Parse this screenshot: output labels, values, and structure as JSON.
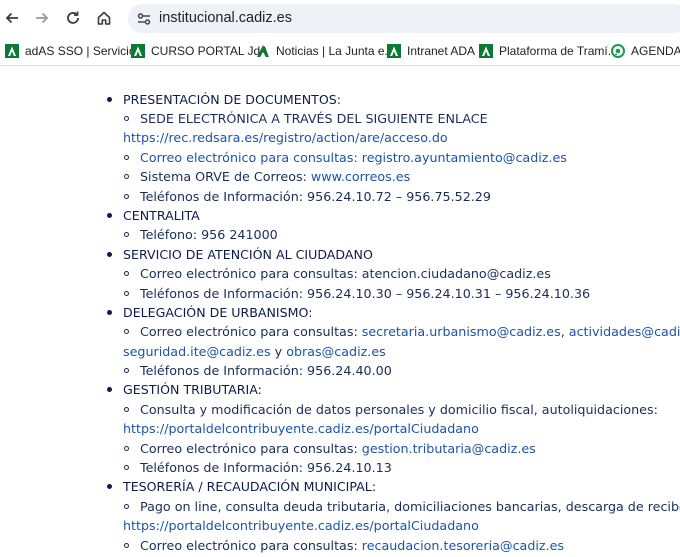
{
  "browser": {
    "url": "institucional.cadiz.es",
    "bookmarks": [
      {
        "label": "adAS SSO | Servicio...",
        "icon": "junta-andalucia-icon"
      },
      {
        "label": "CURSO PORTAL JdA",
        "icon": "junta-andalucia-icon"
      },
      {
        "label": "Noticias | La Junta e...",
        "icon": "junta-andalucia-icon"
      },
      {
        "label": "Intranet ADA",
        "icon": "junta-andalucia-icon"
      },
      {
        "label": "Plataforma de Tramí...",
        "icon": "junta-andalucia-icon"
      },
      {
        "label": "AGENDA S",
        "icon": "agenda-icon"
      }
    ]
  },
  "sections": [
    {
      "heading": "PRESENTACIÓN DE DOCUMENTOS",
      "heading_suffix": ":",
      "items": [
        {
          "text": "SEDE ELECTRÓNICA A TRAVÉS DEL SIGUIENTE ENLACE",
          "link_line": "https://rec.redsara.es/registro/action/are/acceso.do"
        },
        {
          "prefix": "Correo electrónico para consultas: ",
          "link": "registro.ayuntamiento@cadiz.es"
        },
        {
          "prefix": "Sistema ORVE de Correos: ",
          "link": "www.correos.es"
        },
        {
          "text": "Teléfonos de Información: 956.24.10.72 – 956.75.52.29"
        }
      ]
    },
    {
      "heading": "CENTRALITA",
      "items": [
        {
          "text": "Teléfono: 956 241000"
        }
      ]
    },
    {
      "heading": "SERVICIO DE ATENCIÓN AL CIUDADANO",
      "items": [
        {
          "text": "Correo electrónico para consultas: atencion.ciudadano@cadiz.es"
        },
        {
          "text": "Teléfonos de Información: 956.24.10.30 – 956.24.10.31 – 956.24.10.36"
        }
      ]
    },
    {
      "heading": "DELEGACIÓN DE URBANISMO:",
      "items": [
        {
          "prefix": "Correo electrónico para consultas: ",
          "link": "secretaria.urbanismo@cadiz.es",
          "sep": ", ",
          "link2": "actividades@cadiz.es",
          "trail": ",",
          "line2_link1": "seguridad.ite@cadiz.es",
          "line2_sep": " y ",
          "line2_link2": "obras@cadiz.es"
        },
        {
          "text": "Teléfonos de Información: 956.24.40.00"
        }
      ]
    },
    {
      "heading": "GESTIÓN TRIBUTARIA:",
      "items": [
        {
          "text": "Consulta y modificación de datos personales y domicilio fiscal, autoliquidaciones:",
          "link_line": "https://portaldelcontribuyente.cadiz.es/portalCiudadano"
        },
        {
          "prefix": "Correo electrónico para consultas: ",
          "link": "gestion.tributaria@cadiz.es"
        },
        {
          "text": "Teléfonos de Información: 956.24.10.13"
        }
      ]
    },
    {
      "heading": "TESORERÍA / RECAUDACIÓN MUNICIPAL:",
      "items": [
        {
          "text": "Pago on line, consulta deuda tributaria, domiciliaciones bancarias, descarga de recibos:",
          "link_line": "https://portaldelcontribuyente.cadiz.es/portalCiudadano"
        },
        {
          "prefix": "Correo electrónico para consultas: ",
          "link": "recaudacion.tesoreria@cadiz.es"
        }
      ]
    }
  ]
}
